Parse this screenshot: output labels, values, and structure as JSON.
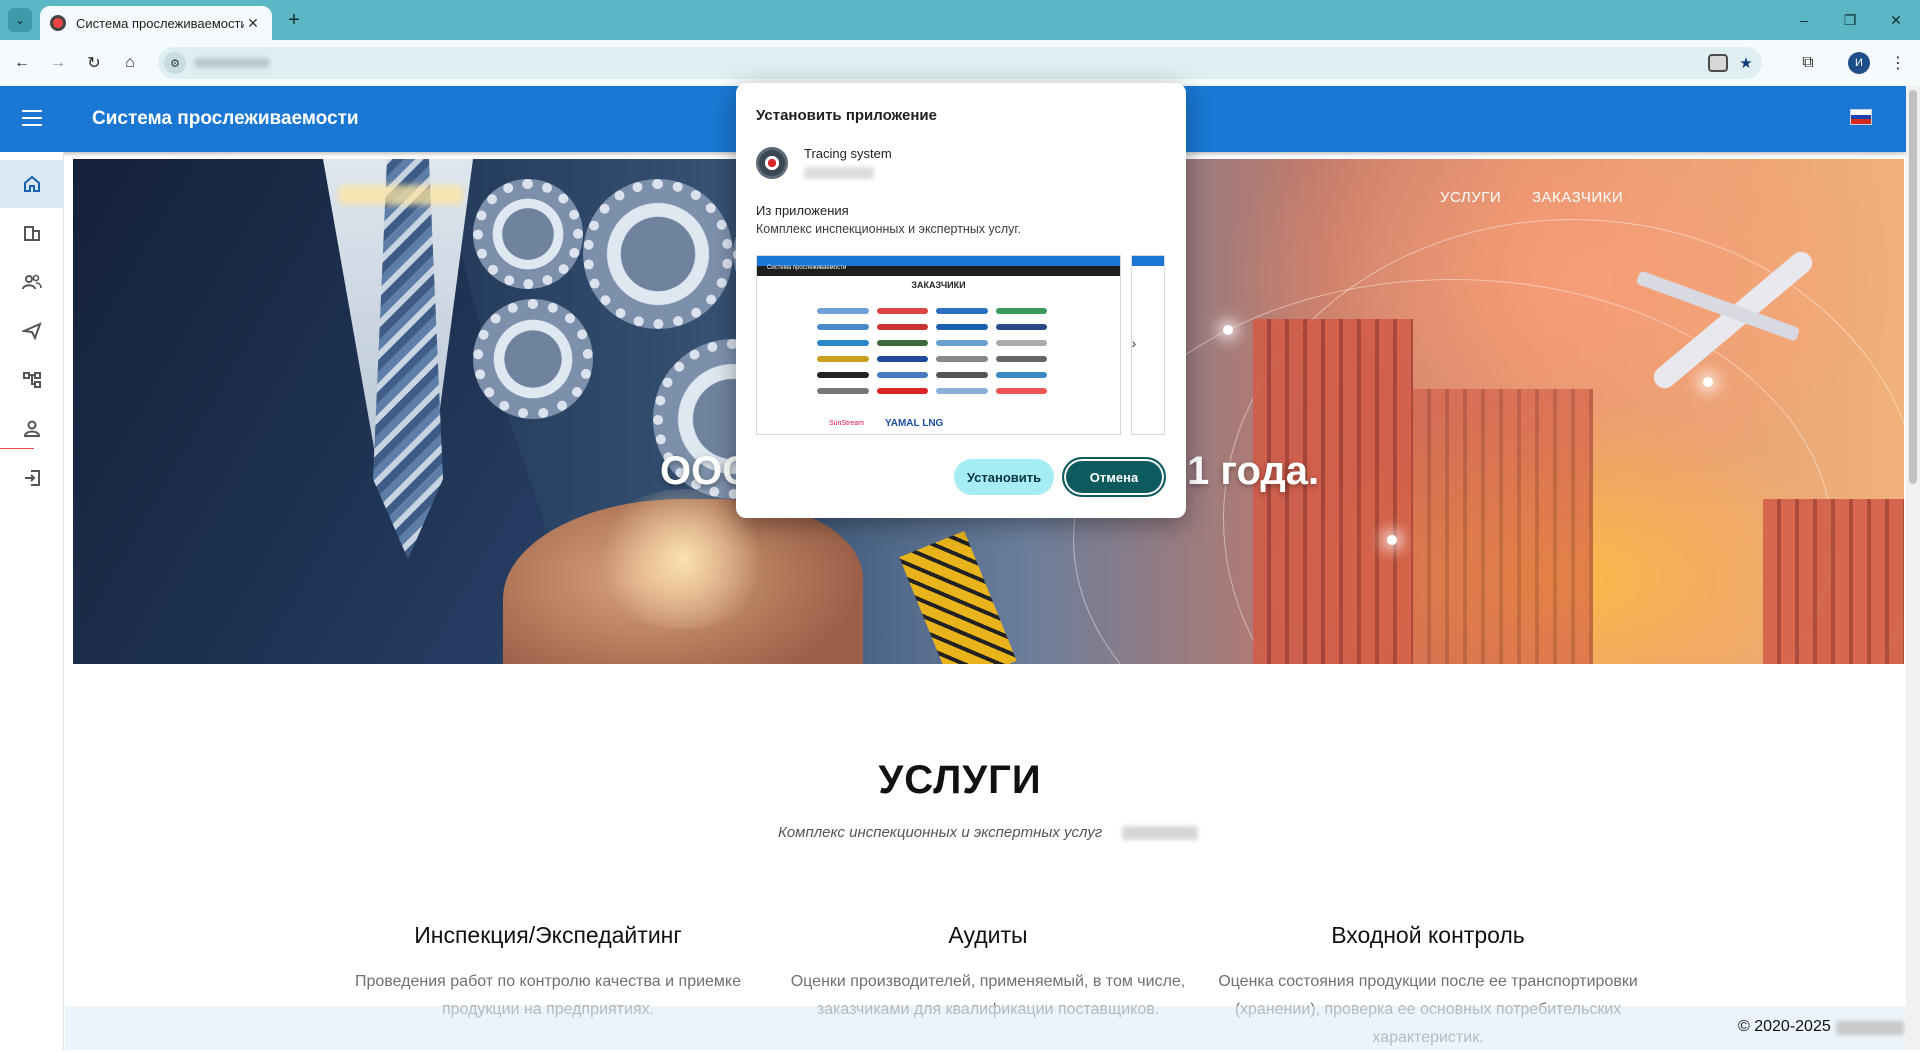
{
  "browser": {
    "tab_title": "Система прослеживаемости",
    "new_tab_label": "+",
    "profile_initial": "И",
    "window_controls": [
      "–",
      "❐",
      "✕"
    ]
  },
  "app": {
    "title": "Система прослеживаемости",
    "language_flag": "russia-flag",
    "brand_color": "#1a78d4"
  },
  "sidebar": {
    "items": [
      {
        "name": "home",
        "icon": "home-icon"
      },
      {
        "name": "organizations",
        "icon": "buildings-icon"
      },
      {
        "name": "users",
        "icon": "people-icon"
      },
      {
        "name": "send",
        "icon": "send-icon"
      },
      {
        "name": "structure",
        "icon": "tree-icon"
      },
      {
        "name": "profile",
        "icon": "person-icon"
      },
      {
        "name": "login",
        "icon": "login-icon"
      }
    ]
  },
  "hero": {
    "nav": [
      "УСЛУГИ",
      "ЗАКАЗЧИКИ"
    ],
    "text_left": "ООС",
    "text_right": "1 года."
  },
  "services": {
    "title": "УСЛУГИ",
    "subtitle": "Комплекс инспекционных и экспертных услуг",
    "columns": [
      {
        "title": "Инспекция/Экспедайтинг",
        "text": "Проведения работ по контролю качества и приемке продукции на предприятиях."
      },
      {
        "title": "Аудиты",
        "text": "Оценки производителей, применяемый, в том числе, заказчиками для квалификации поставщиков."
      },
      {
        "title": "Входной контроль",
        "text": "Оценка состояния продукции после ее транспортировки (хранении), проверка ее основных потребительских характеристик."
      }
    ]
  },
  "footer": {
    "copyright": "© 2020-2025"
  },
  "install_dialog": {
    "title": "Установить приложение",
    "app_name": "Tracing system",
    "from_label": "Из приложения",
    "description": "Комплекс инспекционных и экспертных услуг.",
    "screenshot": {
      "header": "Система прослеживаемости",
      "heading": "ЗАКАЗЧИКИ",
      "logo_text_1": "YAMAL LNG",
      "logo_text_2": "SunStream"
    },
    "install_label": "Установить",
    "cancel_label": "Отмена",
    "install_color": "#a6ecf5",
    "cancel_color": "#0d5a5f"
  }
}
